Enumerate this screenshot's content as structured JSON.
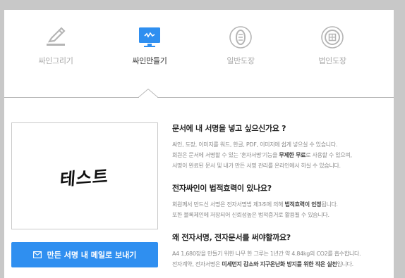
{
  "tabs": [
    {
      "label": "싸인그리기",
      "icon": "pen-draw-icon",
      "active": false
    },
    {
      "label": "싸인만들기",
      "icon": "monitor-signature-icon",
      "active": true
    },
    {
      "label": "일반도장",
      "icon": "stamp-oval-icon",
      "active": false
    },
    {
      "label": "법인도장",
      "icon": "stamp-round-icon",
      "active": false
    }
  ],
  "preview": {
    "signature_text": "테스트"
  },
  "send_button": {
    "label": "만든 서명 내 메일로 보내기",
    "icon": "mail-icon"
  },
  "info": {
    "s1": {
      "title": "문서에 내 서명을 넣고 싶으신가요 ?",
      "l1": "싸인, 도장, 이미지를 워드, 한글, PDF, 이미지에 쉽게 넣으실 수 있습니다.",
      "l2a": "회원은 문서에 서명할 수 있는 '혼자서명'기능을 ",
      "l2b": "무제한 무료",
      "l2c": "로 사용할 수 있으며,",
      "l3": "서명이 완료된 문서 및 내가 만든 서명 관리를 온라인에서 하실 수 있습니다."
    },
    "s2": {
      "title": "전자싸인이 법적효력이 있나요?",
      "l1a": "회원께서 만드신 서명은 전자서명법 제3조에 의해 ",
      "l1b": "법적효력이 인정",
      "l1c": "됩니다.",
      "l2": "또한 블록체인에 저장되어 신뢰성높은 법적증거로 활용될 수 있습니다."
    },
    "s3": {
      "title": "왜 전자서명, 전자문서를 써야할까요?",
      "l1": "A4 1,680장을 만들기 위한 나무 한 그루는 1년간 약 4.84kg의 CO2를 흡수합니다.",
      "l2a": "전자계약, 전자서명은 ",
      "l2b": "미세먼지 감소와 지구온난화 방지를 위한 작은 실천",
      "l2c": "입니다."
    }
  },
  "colors": {
    "accent": "#2f8ff0",
    "inactive_icon": "#b5b5b5"
  }
}
